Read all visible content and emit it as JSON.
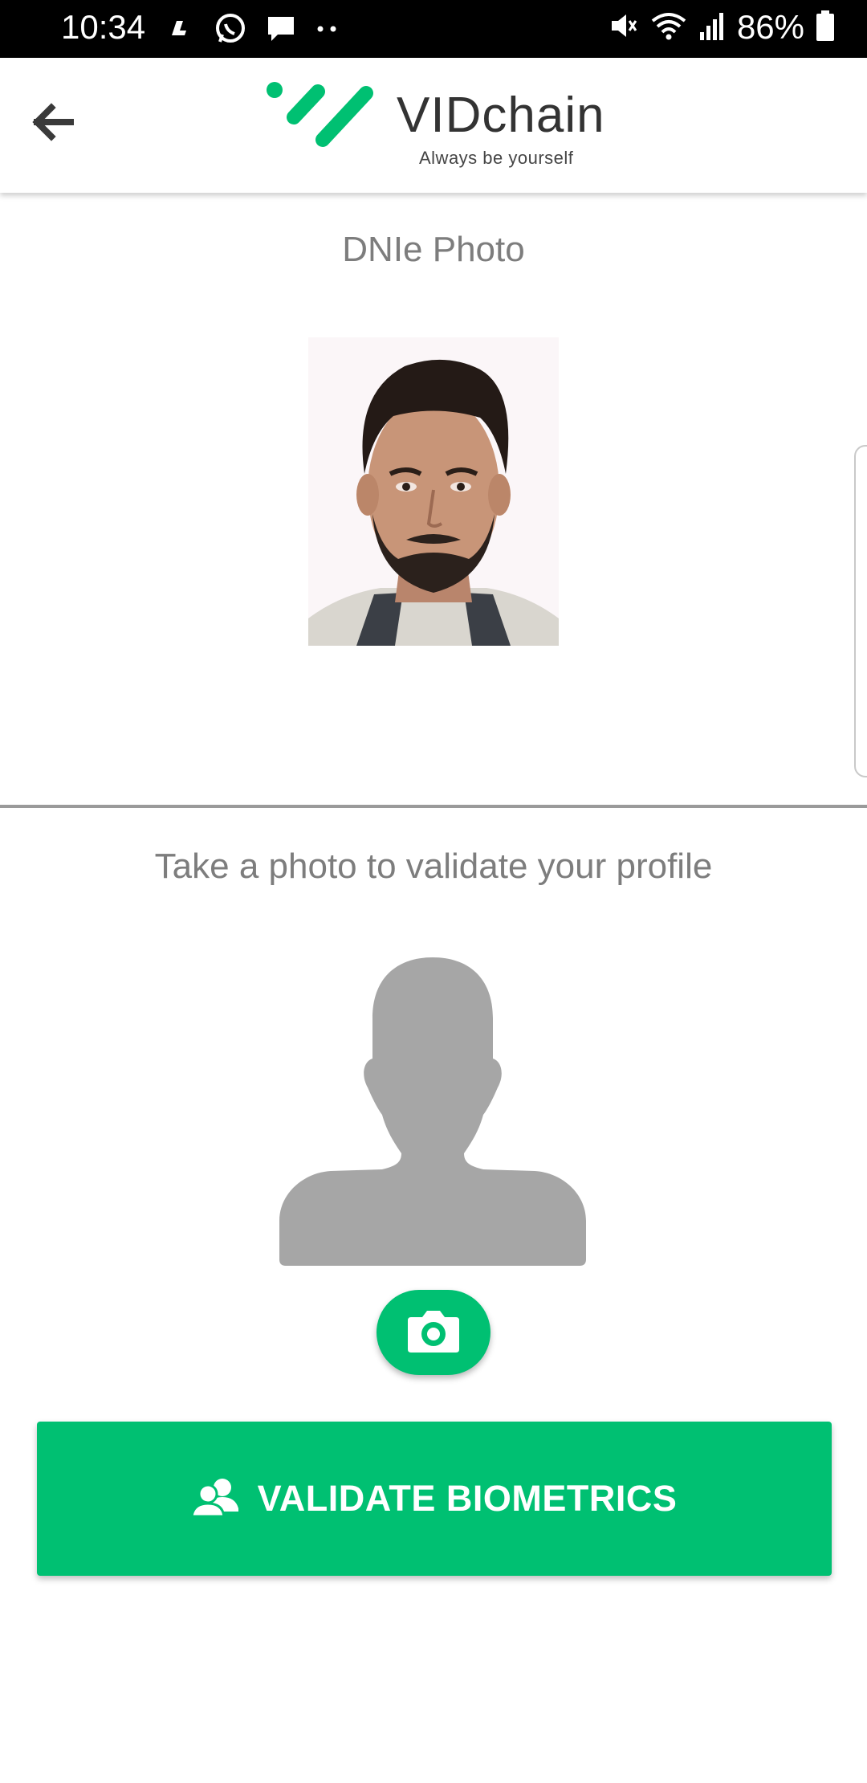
{
  "status_bar": {
    "time": "10:34",
    "battery_percent": "86%",
    "left_icons": [
      "app-icon",
      "whatsapp-icon",
      "message-icon",
      "more-dots-icon"
    ],
    "right_icons": [
      "mute-icon",
      "wifi-icon",
      "signal-icon",
      "battery-icon"
    ]
  },
  "app_bar": {
    "back_icon": "arrow-left-icon",
    "logo": {
      "name": "VIDchain",
      "tagline": "Always be yourself",
      "brand_color": "#00c072"
    }
  },
  "dnie_section": {
    "title": "DNIe Photo"
  },
  "biometric_section": {
    "title": "Take a photo to validate your profile",
    "placeholder_icon": "person-silhouette-icon",
    "camera_icon": "camera-icon"
  },
  "validate_button": {
    "label": "VALIDATE BIOMETRICS",
    "icon": "users-icon",
    "color": "#00c072"
  }
}
